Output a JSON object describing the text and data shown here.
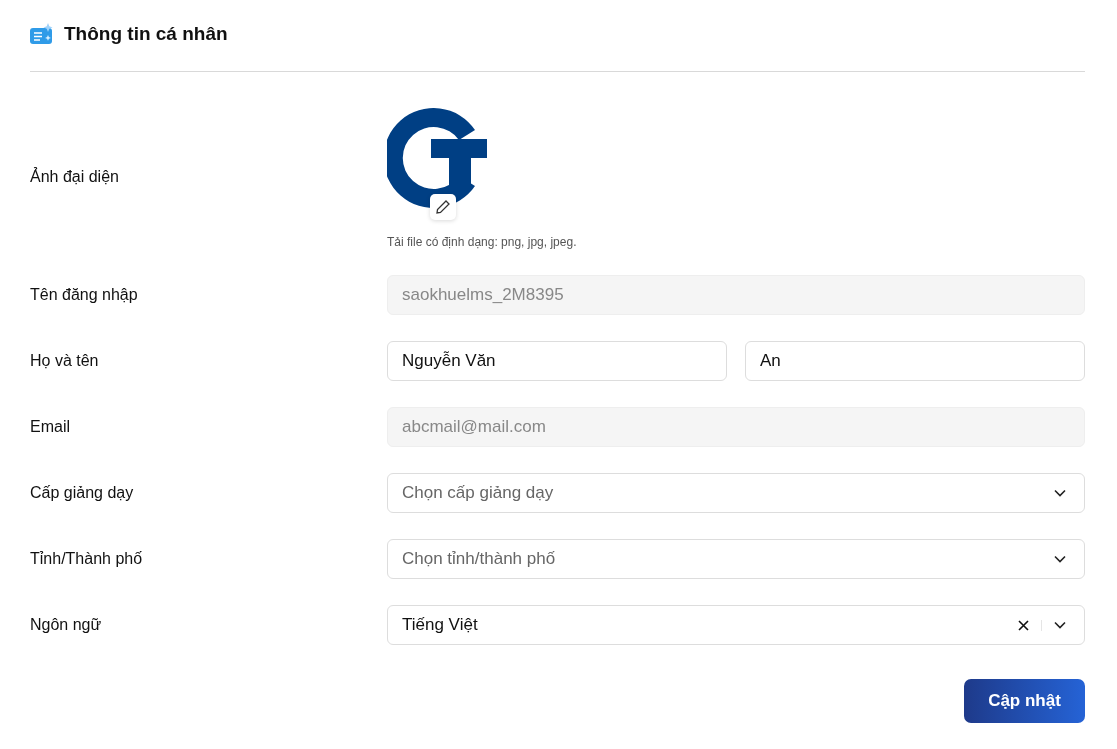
{
  "header": {
    "title": "Thông tin cá nhân"
  },
  "avatar": {
    "label": "Ảnh đại diện",
    "hint": "Tải file có định dạng: png, jpg, jpeg."
  },
  "fields": [
    {
      "label": "Tên đăng nhập",
      "kind": "text",
      "disabled": true,
      "value": "saokhuelms_2M8395"
    },
    {
      "label": "Họ và tên",
      "kind": "name",
      "disabled": false,
      "value": "Nguyễn Văn",
      "value2": "An"
    },
    {
      "label": "Email",
      "kind": "text",
      "disabled": true,
      "value": "abcmail@mail.com"
    },
    {
      "label": "Cấp giảng dạy",
      "kind": "select",
      "placeholder": "Chọn cấp giảng dạy"
    },
    {
      "label": "Tỉnh/Thành phố",
      "kind": "select",
      "placeholder": "Chọn tỉnh/thành phố"
    },
    {
      "label": "Ngôn ngữ",
      "kind": "select",
      "value": "Tiếng Việt",
      "clearable": true
    }
  ],
  "submit": "Cập nhật"
}
